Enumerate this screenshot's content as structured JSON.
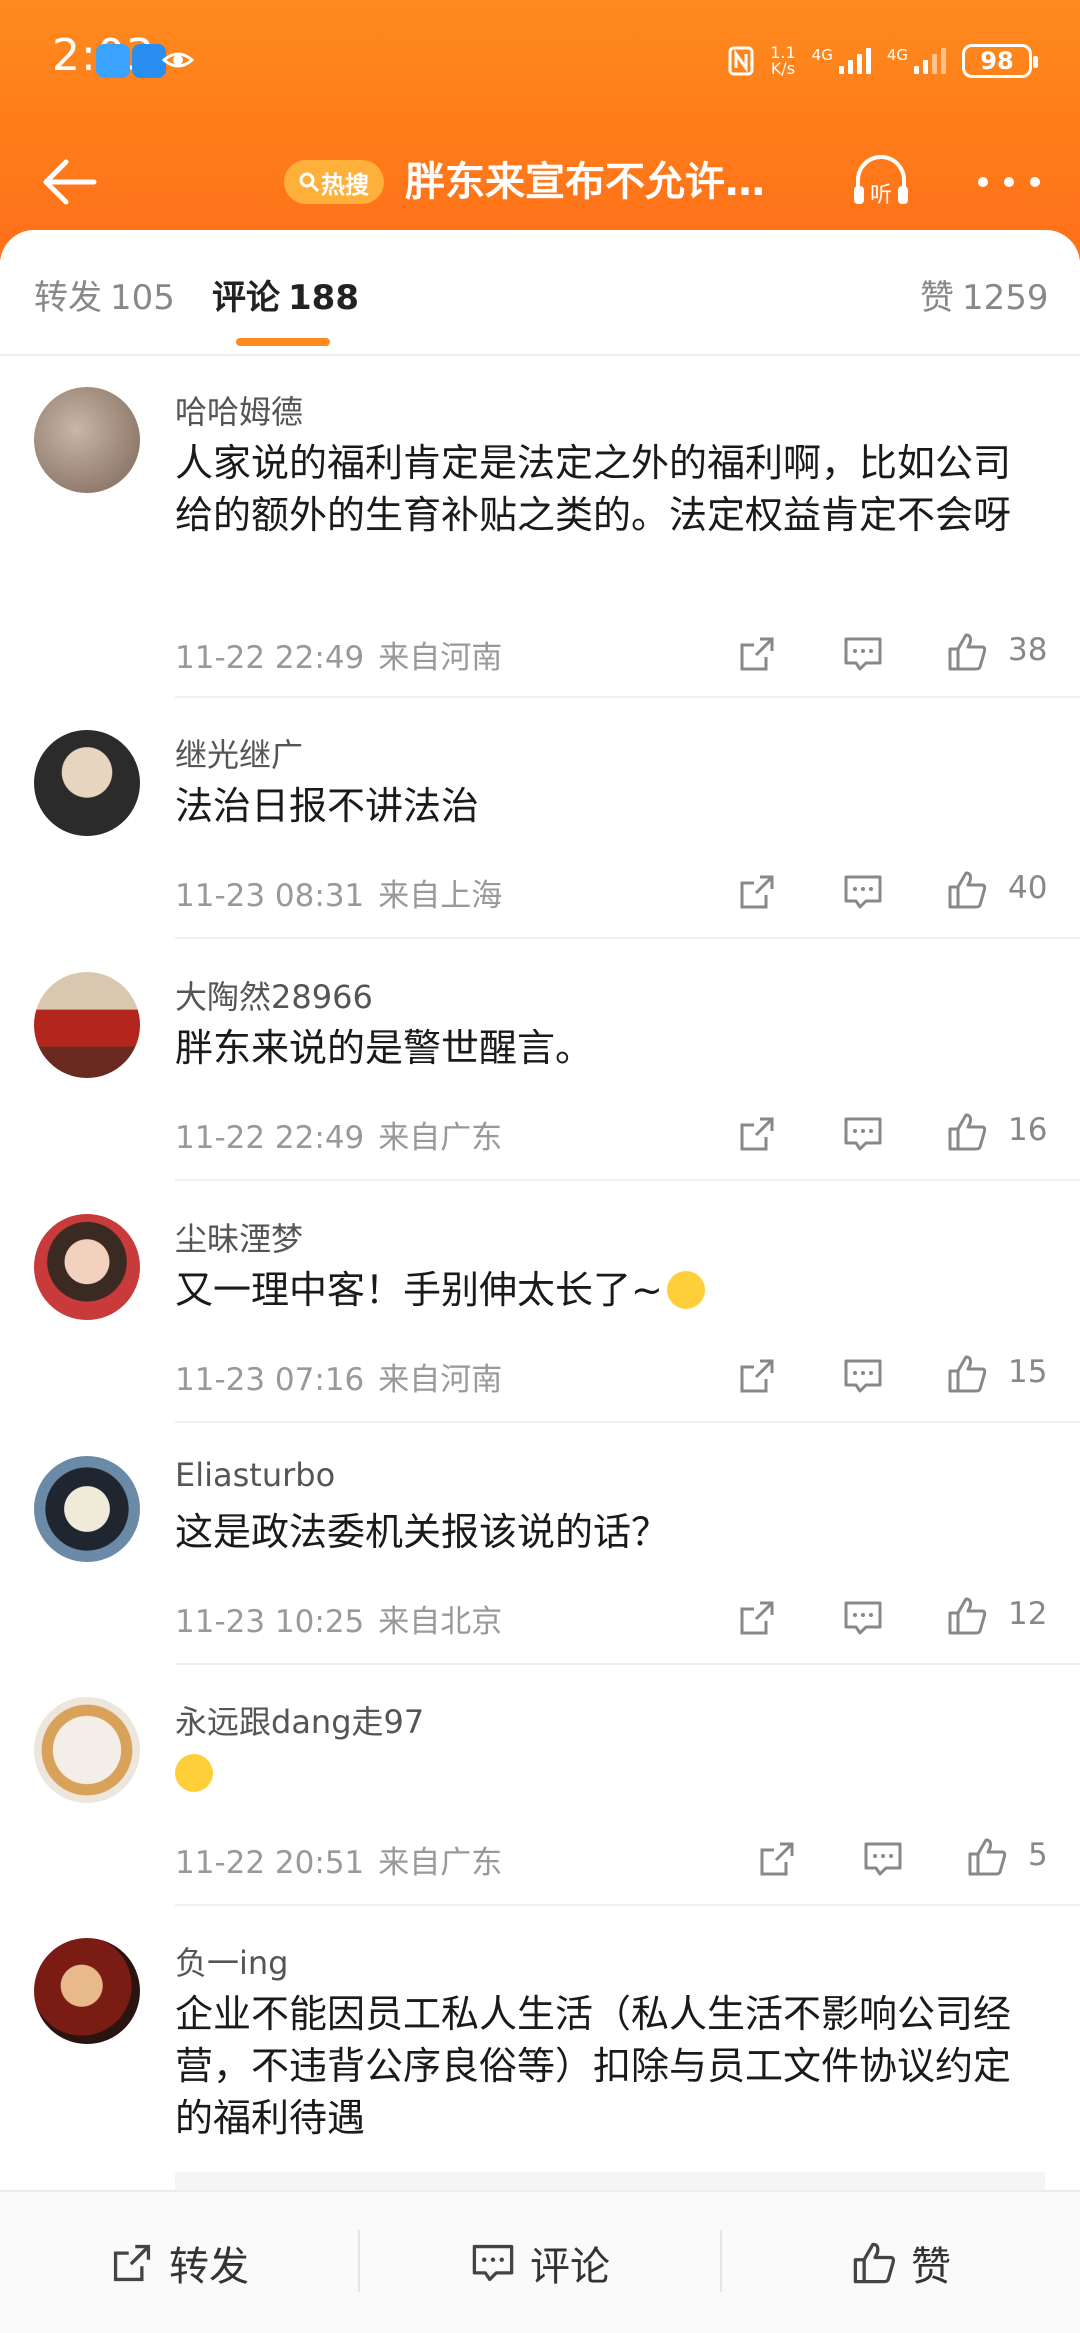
{
  "status_bar": {
    "time": "2:03",
    "netspeed_top": "1.1",
    "netspeed_bottom": "K/s",
    "sig1_label": "4G",
    "sig2_label": "4G",
    "battery": "98"
  },
  "navbar": {
    "hot_badge": "热搜",
    "title": "胖东来宣布不允许…",
    "listen_label": "听"
  },
  "tabs": [
    {
      "label": "转发",
      "count": "105"
    },
    {
      "label": "评论",
      "count": "188"
    },
    {
      "label": "赞",
      "count": "1259"
    }
  ],
  "comments": [
    {
      "user": "哈哈姆德",
      "text": "人家说的福利肯定是法定之外的福利啊，比如公司给的额外的生育补贴之类的。法定权益肯定不会呀",
      "time": "11-22 22:49",
      "location": "来自河南",
      "likes": "38"
    },
    {
      "user": "继光继广",
      "text": "法治日报不讲法治",
      "time": "11-23 08:31",
      "location": "来自上海",
      "likes": "40"
    },
    {
      "user": "大陶然28966",
      "text": "胖东来说的是警世醒言。",
      "time": "11-22 22:49",
      "location": "来自广东",
      "likes": "16"
    },
    {
      "user": "尘昧湮梦",
      "text": "又一理中客！手别伸太长了~",
      "time": "11-23 07:16",
      "location": "来自河南",
      "likes": "15"
    },
    {
      "user": "Eliasturbo",
      "text": "这是政法委机关报该说的话？",
      "time": "11-23 10:25",
      "location": "来自北京",
      "likes": "12"
    },
    {
      "user": "永远跟dang走97",
      "text": "",
      "time": "11-22 20:51",
      "location": "来自广东",
      "likes": "5"
    },
    {
      "user": "负一ing",
      "text": "企业不能因员工私人生活（私人生活不影响公司经营，不违背公序良俗等）扣除与员工文件协议约定的福利待遇",
      "time": "",
      "location": "",
      "likes": ""
    }
  ],
  "bottom_bar": {
    "repost": "转发",
    "comment": "评论",
    "like": "赞"
  },
  "colors": {
    "header": "#ff7a1a",
    "accent": "#ff8a1e",
    "hot_badge": "#ffb03a"
  }
}
